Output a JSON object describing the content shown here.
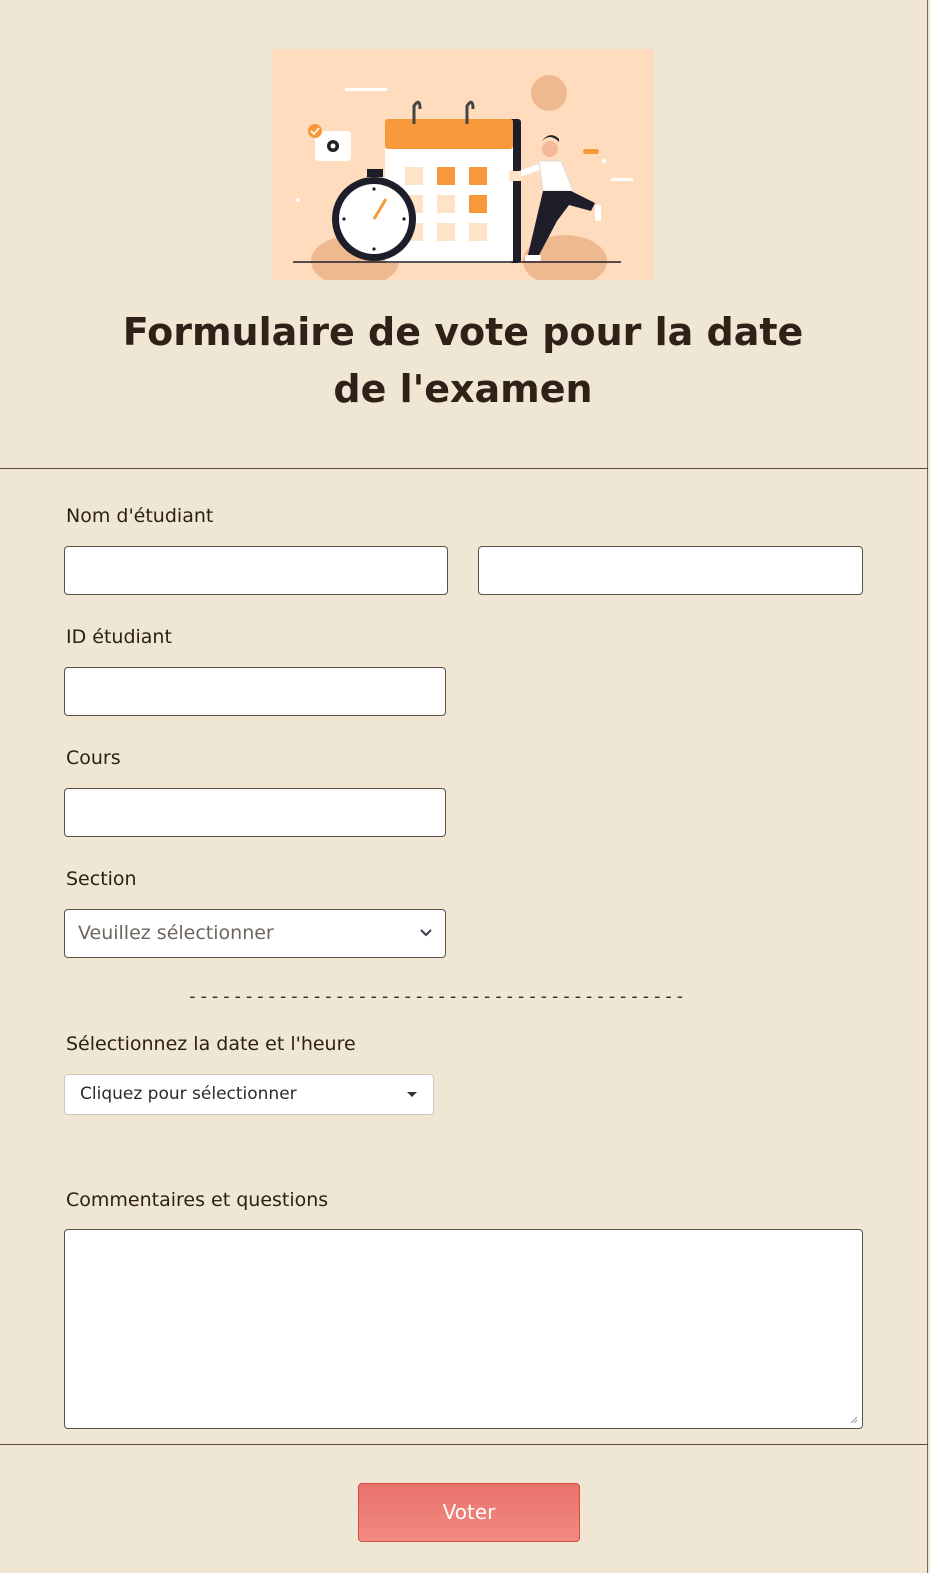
{
  "form": {
    "title": "Formulaire de vote pour la date de l'examen",
    "fields": {
      "student_name": {
        "label": "Nom d'étudiant",
        "first_value": "",
        "last_value": ""
      },
      "student_id": {
        "label": "ID étudiant",
        "value": ""
      },
      "course": {
        "label": "Cours",
        "value": ""
      },
      "section": {
        "label": "Section",
        "selected": "Veuillez sélectionner"
      },
      "divider": "--------------------------------------------",
      "date_time": {
        "label": "Sélectionnez la date et l'heure",
        "selected": "Cliquez pour sélectionner"
      },
      "comments": {
        "label": "Commentaires et questions",
        "value": ""
      }
    },
    "submit_label": "Voter"
  },
  "colors": {
    "background": "#efe6d4",
    "hero_background": "#ffdcbd",
    "accent_orange": "#f7983a",
    "submit": "#ee7d74",
    "text": "#2b1f17"
  },
  "icons": {
    "hero": "exam-calendar-illustration",
    "section_dropdown": "chevron-down-icon",
    "date_dropdown": "caret-down-icon",
    "resize": "resize-grip-icon"
  }
}
